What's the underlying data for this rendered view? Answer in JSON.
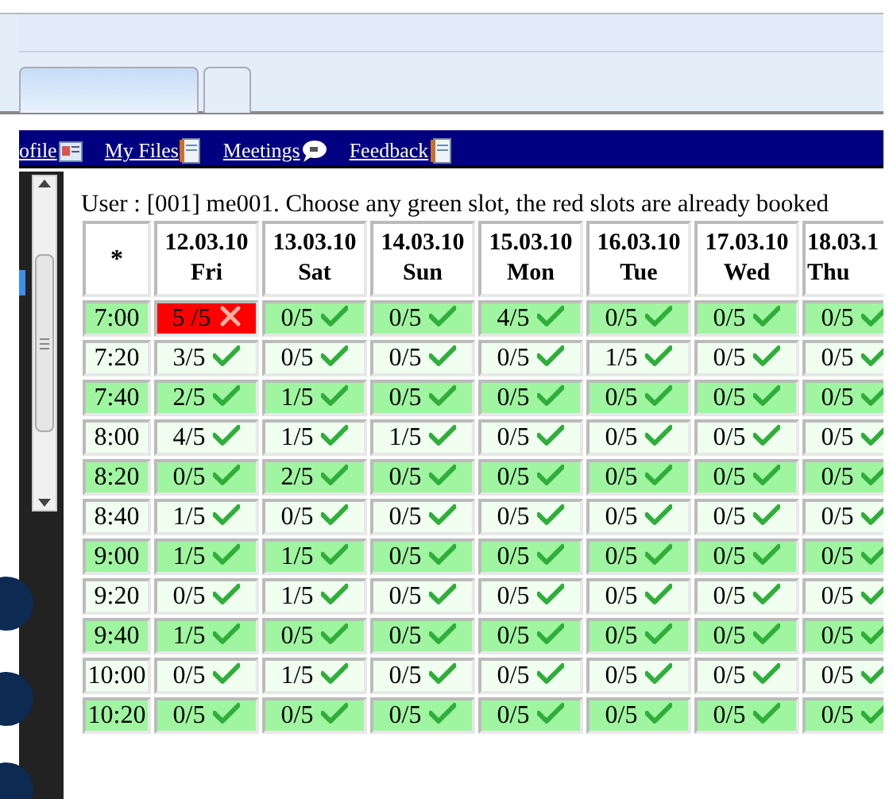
{
  "browser": {
    "tabs": [
      {
        "selected": true
      },
      {
        "selected": false
      }
    ]
  },
  "nav": [
    {
      "label": "ofile"
    },
    {
      "label": "My Files"
    },
    {
      "label": "Meetings"
    },
    {
      "label": "Feedback"
    }
  ],
  "intro": "User : [001] me001. Choose any green slot, the red slots are already booked",
  "table": {
    "corner": "*",
    "columns": [
      {
        "date": "12.03.10",
        "day": "Fri"
      },
      {
        "date": "13.03.10",
        "day": "Sat"
      },
      {
        "date": "14.03.10",
        "day": "Sun"
      },
      {
        "date": "15.03.10",
        "day": "Mon"
      },
      {
        "date": "16.03.10",
        "day": "Tue"
      },
      {
        "date": "17.03.10",
        "day": "Wed"
      },
      {
        "date": "18.03.1",
        "day": "Thu"
      }
    ],
    "rows": [
      {
        "time": "7:00",
        "cells": [
          {
            "text": "5 /5",
            "booked": true
          },
          {
            "text": "0/5",
            "booked": false
          },
          {
            "text": "0/5",
            "booked": false
          },
          {
            "text": "4/5",
            "booked": false
          },
          {
            "text": "0/5",
            "booked": false
          },
          {
            "text": "0/5",
            "booked": false
          },
          {
            "text": "0/5",
            "booked": false
          }
        ]
      },
      {
        "time": "7:20",
        "cells": [
          {
            "text": "3/5",
            "booked": false
          },
          {
            "text": "0/5",
            "booked": false
          },
          {
            "text": "0/5",
            "booked": false
          },
          {
            "text": "0/5",
            "booked": false
          },
          {
            "text": "1/5",
            "booked": false
          },
          {
            "text": "0/5",
            "booked": false
          },
          {
            "text": "0/5",
            "booked": false
          }
        ]
      },
      {
        "time": "7:40",
        "cells": [
          {
            "text": "2/5",
            "booked": false
          },
          {
            "text": "1/5",
            "booked": false
          },
          {
            "text": "0/5",
            "booked": false
          },
          {
            "text": "0/5",
            "booked": false
          },
          {
            "text": "0/5",
            "booked": false
          },
          {
            "text": "0/5",
            "booked": false
          },
          {
            "text": "0/5",
            "booked": false
          }
        ]
      },
      {
        "time": "8:00",
        "cells": [
          {
            "text": "4/5",
            "booked": false
          },
          {
            "text": "1/5",
            "booked": false
          },
          {
            "text": "1/5",
            "booked": false
          },
          {
            "text": "0/5",
            "booked": false
          },
          {
            "text": "0/5",
            "booked": false
          },
          {
            "text": "0/5",
            "booked": false
          },
          {
            "text": "0/5",
            "booked": false
          }
        ]
      },
      {
        "time": "8:20",
        "cells": [
          {
            "text": "0/5",
            "booked": false
          },
          {
            "text": "2/5",
            "booked": false
          },
          {
            "text": "0/5",
            "booked": false
          },
          {
            "text": "0/5",
            "booked": false
          },
          {
            "text": "0/5",
            "booked": false
          },
          {
            "text": "0/5",
            "booked": false
          },
          {
            "text": "0/5",
            "booked": false
          }
        ]
      },
      {
        "time": "8:40",
        "cells": [
          {
            "text": "1/5",
            "booked": false
          },
          {
            "text": "0/5",
            "booked": false
          },
          {
            "text": "0/5",
            "booked": false
          },
          {
            "text": "0/5",
            "booked": false
          },
          {
            "text": "0/5",
            "booked": false
          },
          {
            "text": "0/5",
            "booked": false
          },
          {
            "text": "0/5",
            "booked": false
          }
        ]
      },
      {
        "time": "9:00",
        "cells": [
          {
            "text": "1/5",
            "booked": false
          },
          {
            "text": "1/5",
            "booked": false
          },
          {
            "text": "0/5",
            "booked": false
          },
          {
            "text": "0/5",
            "booked": false
          },
          {
            "text": "0/5",
            "booked": false
          },
          {
            "text": "0/5",
            "booked": false
          },
          {
            "text": "0/5",
            "booked": false
          }
        ]
      },
      {
        "time": "9:20",
        "cells": [
          {
            "text": "0/5",
            "booked": false
          },
          {
            "text": "1/5",
            "booked": false
          },
          {
            "text": "0/5",
            "booked": false
          },
          {
            "text": "0/5",
            "booked": false
          },
          {
            "text": "0/5",
            "booked": false
          },
          {
            "text": "0/5",
            "booked": false
          },
          {
            "text": "0/5",
            "booked": false
          }
        ]
      },
      {
        "time": "9:40",
        "cells": [
          {
            "text": "1/5",
            "booked": false
          },
          {
            "text": "0/5",
            "booked": false
          },
          {
            "text": "0/5",
            "booked": false
          },
          {
            "text": "0/5",
            "booked": false
          },
          {
            "text": "0/5",
            "booked": false
          },
          {
            "text": "0/5",
            "booked": false
          },
          {
            "text": "0/5",
            "booked": false
          }
        ]
      },
      {
        "time": "10:00",
        "cells": [
          {
            "text": "0/5",
            "booked": false
          },
          {
            "text": "1/5",
            "booked": false
          },
          {
            "text": "0/5",
            "booked": false
          },
          {
            "text": "0/5",
            "booked": false
          },
          {
            "text": "0/5",
            "booked": false
          },
          {
            "text": "0/5",
            "booked": false
          },
          {
            "text": "0/5",
            "booked": false
          }
        ]
      },
      {
        "time": "10:20",
        "cells": [
          {
            "text": "0/5",
            "booked": false
          },
          {
            "text": "0/5",
            "booked": false
          },
          {
            "text": "0/5",
            "booked": false
          },
          {
            "text": "0/5",
            "booked": false
          },
          {
            "text": "0/5",
            "booked": false
          },
          {
            "text": "0/5",
            "booked": false
          },
          {
            "text": "0/5",
            "booked": false
          }
        ]
      }
    ]
  }
}
